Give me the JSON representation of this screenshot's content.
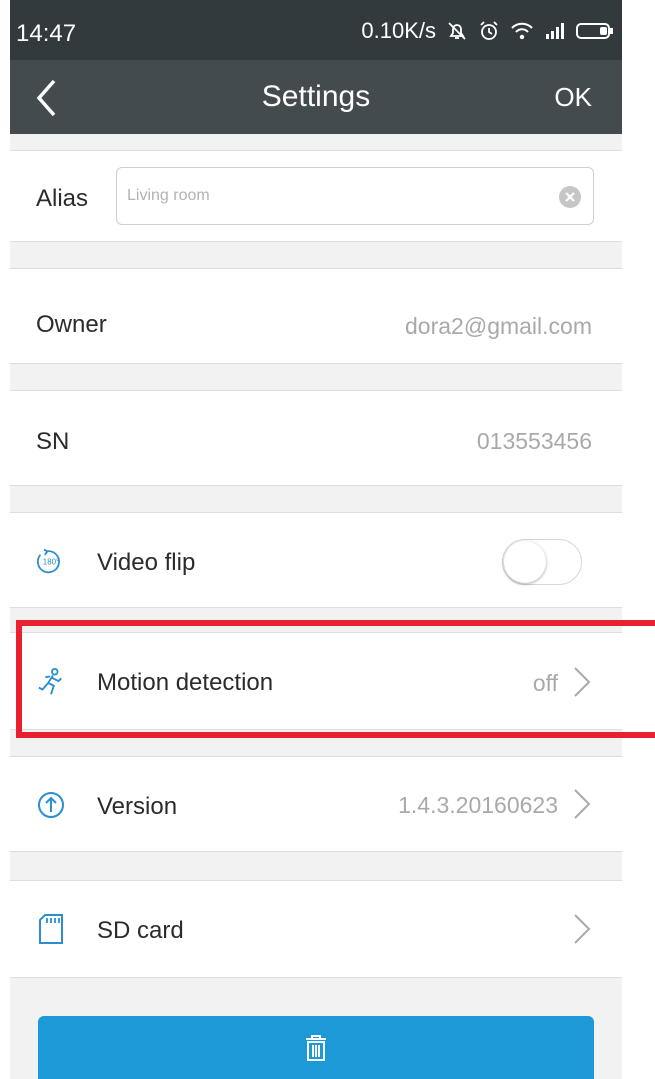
{
  "status_bar": {
    "time": "14:47",
    "network_speed": "0.10K/s",
    "icons": [
      "notification-muted-icon",
      "alarm-icon",
      "wifi-icon",
      "signal-icon",
      "battery-icon"
    ]
  },
  "header": {
    "back_icon": "chevron-left-icon",
    "title": "Settings",
    "ok_label": "OK"
  },
  "alias": {
    "label": "Alias",
    "placeholder": "Living room",
    "value": ""
  },
  "owner": {
    "label": "Owner",
    "value": "dora2@gmail.com"
  },
  "sn": {
    "label": "SN",
    "value": "013553456"
  },
  "video_flip": {
    "icon": "rotate-180-icon",
    "label": "Video flip",
    "enabled": false
  },
  "motion_detection": {
    "icon": "running-person-icon",
    "label": "Motion detection",
    "value": "off"
  },
  "version": {
    "icon": "upload-arrow-icon",
    "label": "Version",
    "value": "1.4.3.20160623"
  },
  "sd_card": {
    "icon": "sd-card-icon",
    "label": "SD card"
  },
  "delete": {
    "icon": "trash-icon"
  },
  "colors": {
    "status_bar": "#333a3d",
    "nav_bar": "#444b4e",
    "accent": "#1b9ad7",
    "highlight": "#e8202f",
    "icon_blue": "#2a8ed0"
  }
}
